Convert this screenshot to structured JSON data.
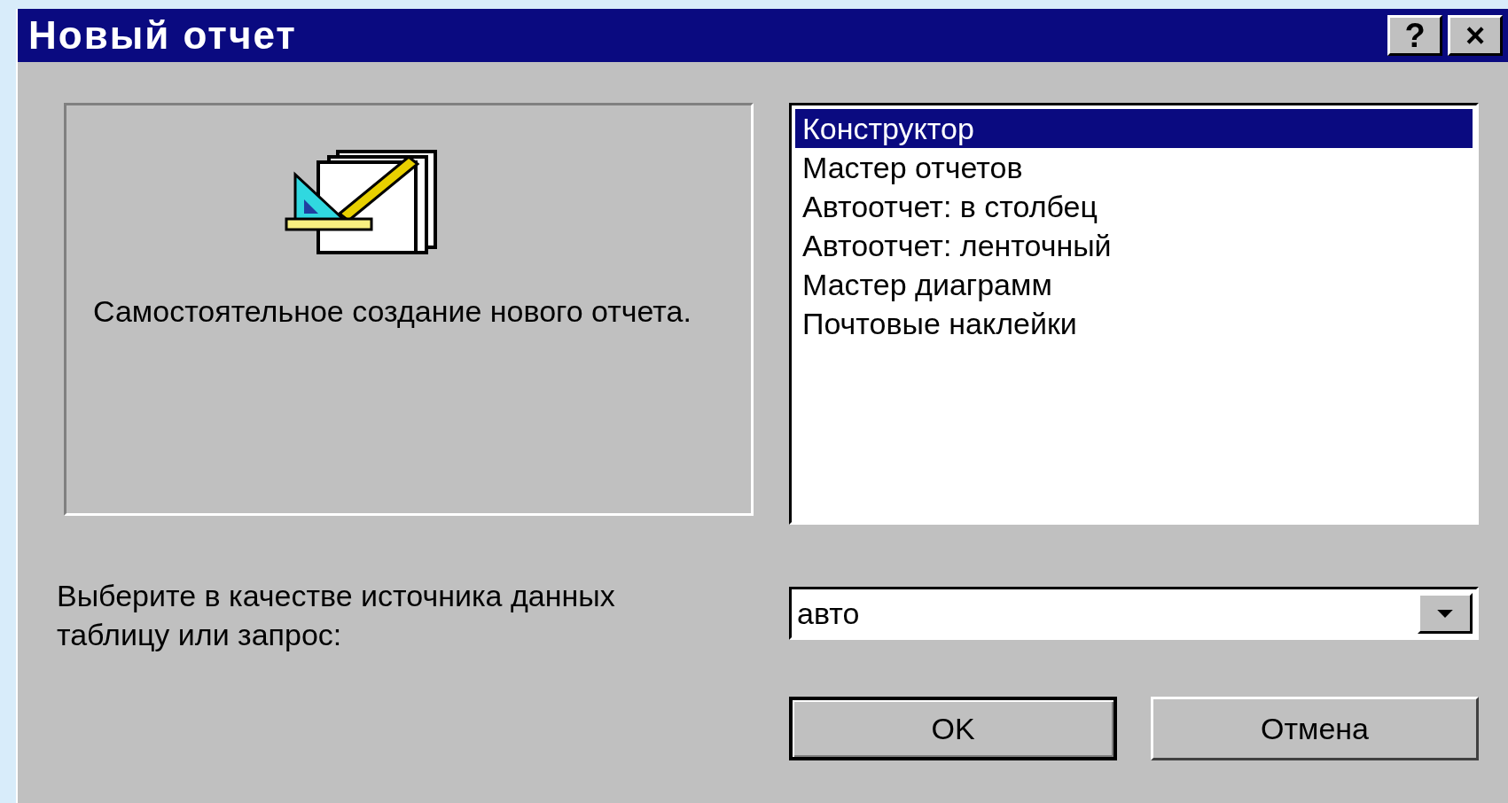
{
  "window": {
    "title": "Новый отчет",
    "buttons": [
      "?",
      "×"
    ]
  },
  "preview": {
    "description": "Самостоятельное создание нового отчета."
  },
  "list": {
    "items": [
      {
        "label": "Конструктор",
        "selected": true
      },
      {
        "label": "Мастер отчетов",
        "selected": false
      },
      {
        "label": "Автоотчет: в столбец",
        "selected": false
      },
      {
        "label": "Автоотчет: ленточный",
        "selected": false
      },
      {
        "label": "Мастер диаграмм",
        "selected": false
      },
      {
        "label": "Почтовые наклейки",
        "selected": false
      }
    ]
  },
  "source": {
    "label": "Выберите в качестве источника данных таблицу или запрос:",
    "value": "авто"
  },
  "buttons": [
    "OK",
    "Отмена"
  ]
}
